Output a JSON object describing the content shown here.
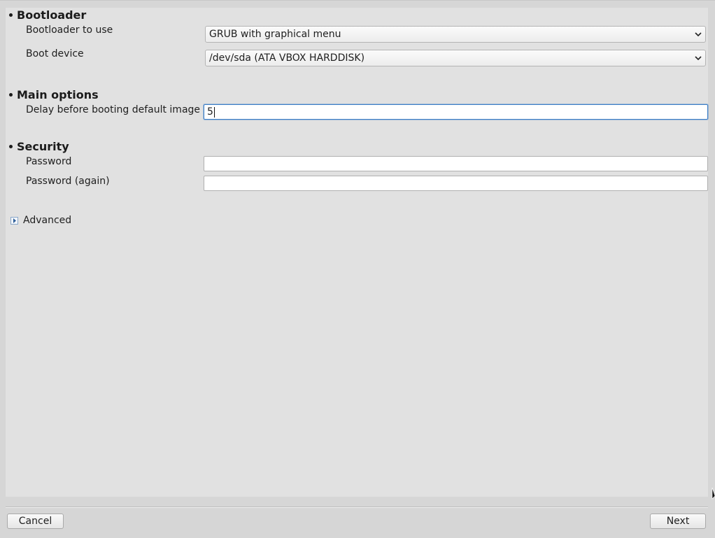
{
  "sections": {
    "bootloader": {
      "title": "Bootloader",
      "bootloader_to_use": {
        "label": "Bootloader to use",
        "value": "GRUB with graphical menu"
      },
      "boot_device": {
        "label": "Boot device",
        "value": "/dev/sda (ATA VBOX HARDDISK)"
      }
    },
    "main_options": {
      "title": "Main options",
      "delay": {
        "label": "Delay before booting default image",
        "value": "5"
      }
    },
    "security": {
      "title": "Security",
      "password": {
        "label": "Password",
        "value": ""
      },
      "password_again": {
        "label": "Password (again)",
        "value": ""
      }
    }
  },
  "advanced": {
    "label": "Advanced",
    "expanded": false,
    "icon": "expander-arrow-icon"
  },
  "buttons": {
    "cancel": "Cancel",
    "next": "Next"
  },
  "colors": {
    "focus_border": "#3c7ec7",
    "panel_bg": "#e1e1e1",
    "window_bg": "#d6d6d6"
  }
}
